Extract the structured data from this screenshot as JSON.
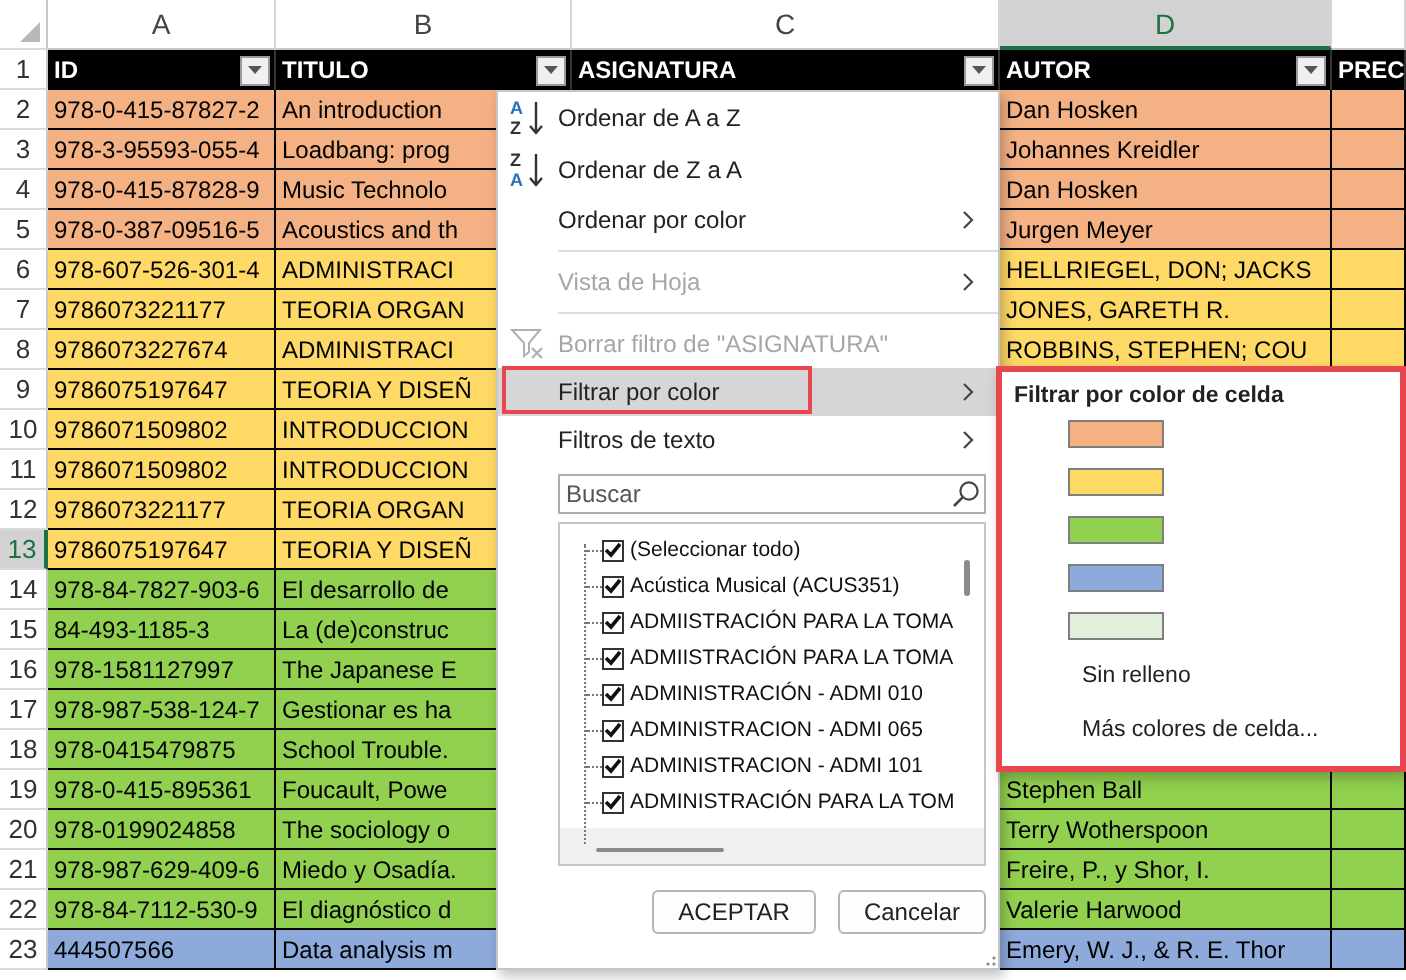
{
  "sheet": {
    "columns": [
      {
        "letter": "A",
        "selected": false
      },
      {
        "letter": "B",
        "selected": false
      },
      {
        "letter": "C",
        "selected": false
      },
      {
        "letter": "D",
        "selected": true
      }
    ],
    "header": {
      "number": "1",
      "selected": false,
      "cells": [
        {
          "text": "ID",
          "filter": true
        },
        {
          "text": "TITULO",
          "filter": true
        },
        {
          "text": "ASIGNATURA",
          "filter": true
        },
        {
          "text": "AUTOR",
          "filter": true
        },
        {
          "text": "PREC",
          "filter": false
        }
      ]
    },
    "rows": [
      {
        "number": "2",
        "selected": false,
        "color": "#f4b183",
        "id": "978-0-415-87827-2",
        "title": "An introduction",
        "author": "Dan Hosken"
      },
      {
        "number": "3",
        "selected": false,
        "color": "#f4b183",
        "id": "978-3-95593-055-4",
        "title": "Loadbang: prog",
        "author": "Johannes Kreidler"
      },
      {
        "number": "4",
        "selected": false,
        "color": "#f4b183",
        "id": "978-0-415-87828-9",
        "title": "Music Technolo",
        "author": "Dan Hosken"
      },
      {
        "number": "5",
        "selected": false,
        "color": "#f4b183",
        "id": "978-0-387-09516-5",
        "title": "Acoustics and th",
        "author": "Jurgen Meyer"
      },
      {
        "number": "6",
        "selected": false,
        "color": "#ffd966",
        "id": "978-607-526-301-4",
        "title": "ADMINISTRACI",
        "author": "HELLRIEGEL, DON; JACKS"
      },
      {
        "number": "7",
        "selected": false,
        "color": "#ffd966",
        "id": "9786073221177",
        "title": "TEORIA ORGAN",
        "author": "JONES, GARETH R."
      },
      {
        "number": "8",
        "selected": false,
        "color": "#ffd966",
        "id": "9786073227674",
        "title": "ADMINISTRACI",
        "author": "ROBBINS, STEPHEN; COU"
      },
      {
        "number": "9",
        "selected": false,
        "color": "#ffd966",
        "id": "9786075197647",
        "title": "TEORIA Y DISEÑ"
      },
      {
        "number": "10",
        "selected": false,
        "color": "#ffd966",
        "id": "9786071509802",
        "title": "INTRODUCCION"
      },
      {
        "number": "11",
        "selected": false,
        "color": "#ffd966",
        "id": "9786071509802",
        "title": "INTRODUCCION"
      },
      {
        "number": "12",
        "selected": false,
        "color": "#ffd966",
        "id": "9786073221177",
        "title": "TEORIA ORGAN"
      },
      {
        "number": "13",
        "selected": true,
        "color": "#ffd966",
        "id": "9786075197647",
        "title": "TEORIA Y DISEÑ"
      },
      {
        "number": "14",
        "selected": false,
        "color": "#92d050",
        "id": "978-84-7827-903-6",
        "title": "El desarrollo de"
      },
      {
        "number": "15",
        "selected": false,
        "color": "#92d050",
        "id": "84-493-1185-3",
        "title": "La (de)construc"
      },
      {
        "number": "16",
        "selected": false,
        "color": "#92d050",
        "id": "978-1581127997",
        "title": "The Japanese E"
      },
      {
        "number": "17",
        "selected": false,
        "color": "#92d050",
        "id": "978-987-538-124-7",
        "title": "Gestionar es ha"
      },
      {
        "number": "18",
        "selected": false,
        "color": "#92d050",
        "id": "978-0415479875",
        "title": "School Trouble."
      },
      {
        "number": "19",
        "selected": false,
        "color": "#92d050",
        "id": "978-0-415-895361",
        "title": "Foucault, Powe",
        "author": "Stephen Ball"
      },
      {
        "number": "20",
        "selected": false,
        "color": "#92d050",
        "id": "978-0199024858",
        "title": "The sociology o",
        "author": "Terry Wotherspoon"
      },
      {
        "number": "21",
        "selected": false,
        "color": "#92d050",
        "id": "978-987-629-409-6",
        "title": "Miedo y Osadía.",
        "author": "Freire, P., y Shor, I."
      },
      {
        "number": "22",
        "selected": false,
        "color": "#92d050",
        "id": "978-84-7112-530-9",
        "title": "El diagnóstico d",
        "author": "Valerie Harwood"
      },
      {
        "number": "23",
        "selected": false,
        "color": "#8eaadb",
        "id": "444507566",
        "title": "Data analysis m",
        "author": "Emery, W. J., & R. E. Thor"
      }
    ]
  },
  "menu": {
    "items": [
      {
        "kind": "sort",
        "icon_letters": [
          {
            "text": "A",
            "color": "#2a6ebb"
          },
          {
            "text": "Z",
            "color": "#333333"
          }
        ],
        "label": "Ordenar de A a Z",
        "submenu": false,
        "disabled": false,
        "selected": false,
        "annotated": false
      },
      {
        "kind": "sort",
        "icon_letters": [
          {
            "text": "Z",
            "color": "#333333"
          },
          {
            "text": "A",
            "color": "#2a6ebb"
          }
        ],
        "label": "Ordenar de Z a A",
        "submenu": false,
        "disabled": false,
        "selected": false,
        "annotated": false
      },
      {
        "kind": "plain",
        "label": "Ordenar por color",
        "submenu": true,
        "disabled": false,
        "selected": false,
        "annotated": false
      },
      {
        "kind": "separator"
      },
      {
        "kind": "plain",
        "label": "Vista de Hoja",
        "submenu": true,
        "disabled": true,
        "selected": false,
        "annotated": false
      },
      {
        "kind": "separator"
      },
      {
        "kind": "clear",
        "label": "Borrar filtro de \"ASIGNATURA\"",
        "submenu": false,
        "disabled": true,
        "selected": false,
        "annotated": false
      },
      {
        "kind": "plain",
        "label": "Filtrar por color",
        "submenu": true,
        "disabled": false,
        "selected": true,
        "annotated": true
      },
      {
        "kind": "plain",
        "label": "Filtros de texto",
        "submenu": true,
        "disabled": false,
        "selected": false,
        "annotated": false
      }
    ],
    "search": {
      "placeholder": "Buscar"
    },
    "list": [
      {
        "label": "(Seleccionar todo)",
        "checked": true
      },
      {
        "label": "Acústica Musical (ACUS351)",
        "checked": true
      },
      {
        "label": "ADMIISTRACIÓN PARA LA TOMA",
        "checked": true
      },
      {
        "label": "ADMIISTRACIÓN PARA LA TOMA",
        "checked": true
      },
      {
        "label": "ADMINISTRACIÓN - ADMI 010",
        "checked": true
      },
      {
        "label": "ADMINISTRACION - ADMI 065",
        "checked": true
      },
      {
        "label": "ADMINISTRACION - ADMI 101",
        "checked": true
      },
      {
        "label": "ADMINISTRACIÓN PARA LA TOM",
        "checked": true
      }
    ],
    "buttons": [
      "ACEPTAR",
      "Cancelar"
    ]
  },
  "submenu": {
    "title": "Filtrar por color de celda",
    "annotated": true,
    "swatches": [
      {
        "color": "#f4b183"
      },
      {
        "color": "#ffd966"
      },
      {
        "color": "#92d050"
      },
      {
        "color": "#8eaadb"
      },
      {
        "color": "#e2efda"
      }
    ],
    "options": [
      "Sin relleno",
      "Más colores de celda..."
    ]
  }
}
